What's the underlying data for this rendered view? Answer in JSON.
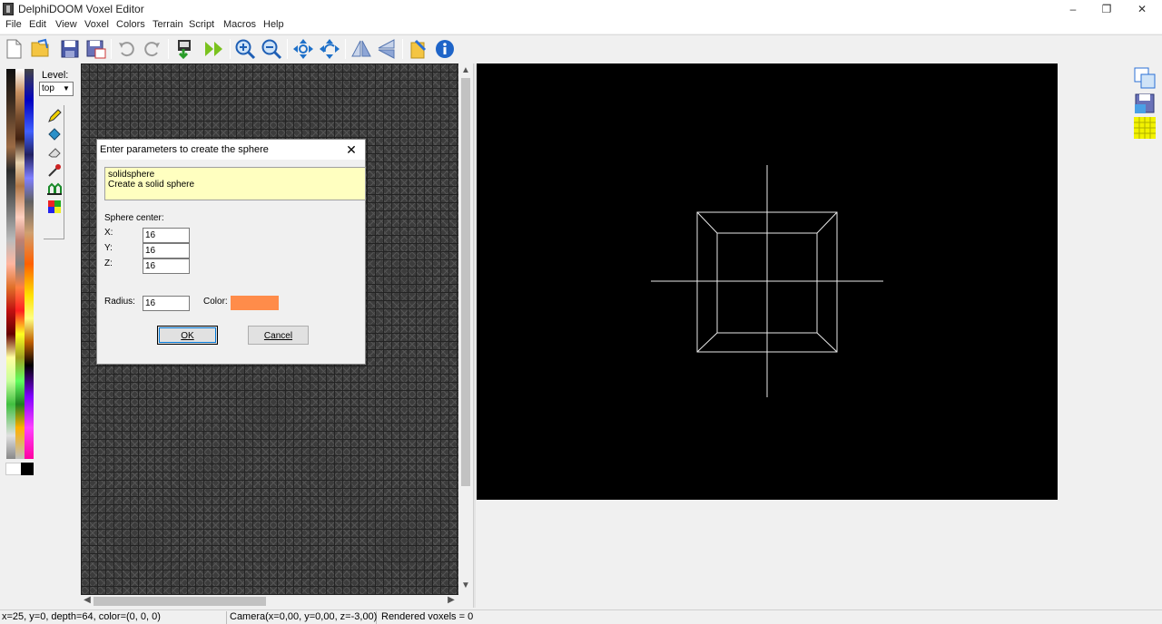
{
  "window": {
    "title": "DelphiDOOM Voxel Editor",
    "minimize": "–",
    "restore": "❐",
    "close": "✕"
  },
  "menu": [
    "File",
    "Edit",
    "View",
    "Voxel",
    "Colors",
    "Terrain",
    "Script",
    "Macros",
    "Help"
  ],
  "left_panel": {
    "level_label": "Level:",
    "level_value": "top"
  },
  "dialog": {
    "title": "Enter parameters to create the sphere",
    "close": "✕",
    "script_name": "solidsphere",
    "script_description": "Create a solid sphere",
    "center_label": "Sphere center:",
    "x_label": "X:",
    "x_value": "16",
    "y_label": "Y:",
    "y_value": "16",
    "z_label": "Z:",
    "z_value": "16",
    "radius_label": "Radius:",
    "radius_value": "16",
    "color_label": "Color:",
    "color_value": "#ff8c4a",
    "ok_label": "OK",
    "cancel_label": "Cancel"
  },
  "status": {
    "position": "x=25, y=0, depth=64, color=(0, 0, 0)",
    "camera": "Camera(x=0,00, y=0,00, z=-3,00)",
    "rendered": "Rendered voxels = 0"
  },
  "colors": {
    "grid_bg": "#3c3c3c",
    "viewport_bg": "#000000",
    "wireframe": "#e8e8e8",
    "desc_bg": "#ffffc0"
  }
}
